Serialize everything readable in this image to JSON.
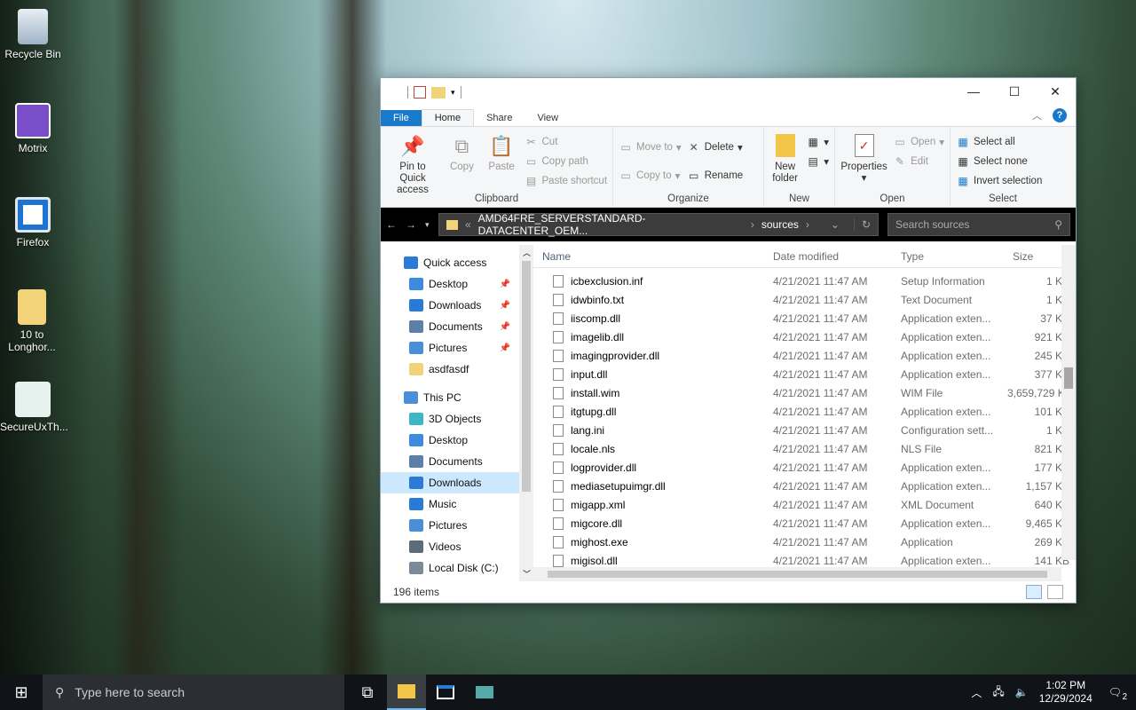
{
  "desktop": {
    "icons": [
      {
        "label": "Recycle Bin"
      },
      {
        "label": "Motrix"
      },
      {
        "label": "Firefox"
      },
      {
        "label": "10 to Longhor..."
      },
      {
        "label": "SecureUxTh..."
      }
    ]
  },
  "explorer": {
    "tabs": {
      "file": "File",
      "home": "Home",
      "share": "Share",
      "view": "View"
    },
    "ribbon": {
      "clipboard": {
        "group": "Clipboard",
        "pin": "Pin to Quick access",
        "copy": "Copy",
        "paste": "Paste",
        "cut": "Cut",
        "copy_path": "Copy path",
        "paste_shortcut": "Paste shortcut"
      },
      "organize": {
        "group": "Organize",
        "move_to": "Move to",
        "copy_to": "Copy to",
        "delete": "Delete",
        "rename": "Rename"
      },
      "new": {
        "group": "New",
        "new_folder": "New folder"
      },
      "open": {
        "group": "Open",
        "properties": "Properties",
        "open": "Open",
        "edit": "Edit"
      },
      "select": {
        "group": "Select",
        "select_all": "Select all",
        "select_none": "Select none",
        "invert": "Invert selection"
      }
    },
    "address": {
      "segments": [
        "AMD64FRE_SERVERSTANDARD-DATACENTER_OEM...",
        "sources"
      ],
      "search_placeholder": "Search sources"
    },
    "nav": [
      {
        "label": "Quick access",
        "top": true
      },
      {
        "label": "Desktop",
        "pin": true
      },
      {
        "label": "Downloads",
        "pin": true
      },
      {
        "label": "Documents",
        "pin": true
      },
      {
        "label": "Pictures",
        "pin": true
      },
      {
        "label": "asdfasdf"
      },
      {
        "label": "This PC",
        "top": true
      },
      {
        "label": "3D Objects"
      },
      {
        "label": "Desktop"
      },
      {
        "label": "Documents"
      },
      {
        "label": "Downloads",
        "selected": true
      },
      {
        "label": "Music"
      },
      {
        "label": "Pictures"
      },
      {
        "label": "Videos"
      },
      {
        "label": "Local Disk (C:)"
      }
    ],
    "columns": {
      "name": "Name",
      "date": "Date modified",
      "type": "Type",
      "size": "Size"
    },
    "files": [
      {
        "name": "icbexclusion.inf",
        "date": "4/21/2021 11:47 AM",
        "type": "Setup Information",
        "size": "1 KB"
      },
      {
        "name": "idwbinfo.txt",
        "date": "4/21/2021 11:47 AM",
        "type": "Text Document",
        "size": "1 KB"
      },
      {
        "name": "iiscomp.dll",
        "date": "4/21/2021 11:47 AM",
        "type": "Application exten...",
        "size": "37 KB"
      },
      {
        "name": "imagelib.dll",
        "date": "4/21/2021 11:47 AM",
        "type": "Application exten...",
        "size": "921 KB"
      },
      {
        "name": "imagingprovider.dll",
        "date": "4/21/2021 11:47 AM",
        "type": "Application exten...",
        "size": "245 KB"
      },
      {
        "name": "input.dll",
        "date": "4/21/2021 11:47 AM",
        "type": "Application exten...",
        "size": "377 KB"
      },
      {
        "name": "install.wim",
        "date": "4/21/2021 11:47 AM",
        "type": "WIM File",
        "size": "3,659,729 KB"
      },
      {
        "name": "itgtupg.dll",
        "date": "4/21/2021 11:47 AM",
        "type": "Application exten...",
        "size": "101 KB"
      },
      {
        "name": "lang.ini",
        "date": "4/21/2021 11:47 AM",
        "type": "Configuration sett...",
        "size": "1 KB"
      },
      {
        "name": "locale.nls",
        "date": "4/21/2021 11:47 AM",
        "type": "NLS File",
        "size": "821 KB"
      },
      {
        "name": "logprovider.dll",
        "date": "4/21/2021 11:47 AM",
        "type": "Application exten...",
        "size": "177 KB"
      },
      {
        "name": "mediasetupuimgr.dll",
        "date": "4/21/2021 11:47 AM",
        "type": "Application exten...",
        "size": "1,157 KB"
      },
      {
        "name": "migapp.xml",
        "date": "4/21/2021 11:47 AM",
        "type": "XML Document",
        "size": "640 KB"
      },
      {
        "name": "migcore.dll",
        "date": "4/21/2021 11:47 AM",
        "type": "Application exten...",
        "size": "9,465 KB"
      },
      {
        "name": "mighost.exe",
        "date": "4/21/2021 11:47 AM",
        "type": "Application",
        "size": "269 KB"
      },
      {
        "name": "migisol.dll",
        "date": "4/21/2021 11:47 AM",
        "type": "Application exten...",
        "size": "141 KB"
      }
    ],
    "status": "196 items"
  },
  "taskbar": {
    "search_placeholder": "Type here to search",
    "time": "1:02 PM",
    "date": "12/29/2024",
    "notifications": "2"
  },
  "colors": {
    "accent": "#1979ca",
    "selection": "#cce8ff"
  }
}
